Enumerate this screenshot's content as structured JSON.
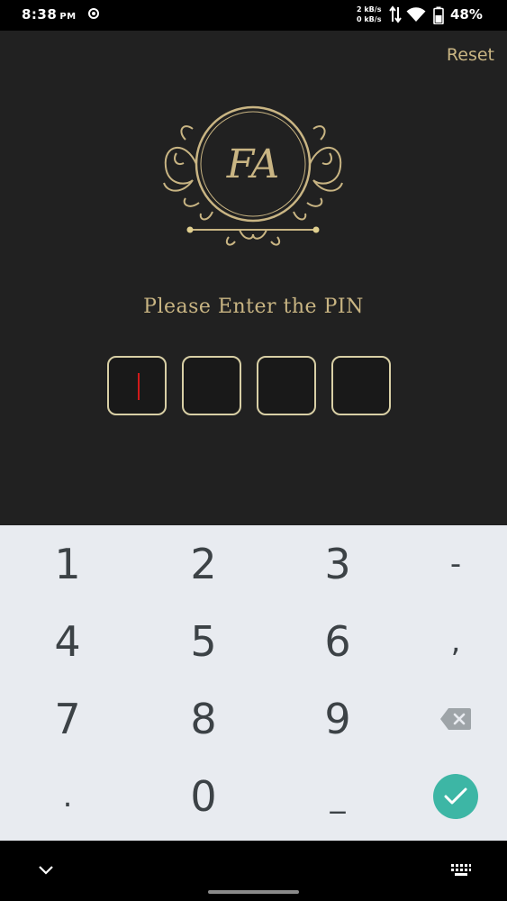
{
  "status_bar": {
    "time": "8:38",
    "ampm": "PM",
    "speed_up": "2 kB/s",
    "speed_down": "0 kB/s",
    "battery": "48%"
  },
  "app": {
    "reset_label": "Reset",
    "logo_text": "FA",
    "prompt": "Please Enter the PIN",
    "pin_length": 4
  },
  "keyboard": {
    "keys": [
      [
        "1",
        "2",
        "3",
        "-"
      ],
      [
        "4",
        "5",
        "6",
        ","
      ],
      [
        "7",
        "8",
        "9",
        "backspace-icon"
      ],
      [
        ".",
        "0",
        "_",
        "check-icon"
      ]
    ],
    "enter_color": "#3db6a5"
  },
  "colors": {
    "accent_gold": "#c9b583",
    "background": "#212121",
    "cursor": "#d11a1a"
  }
}
